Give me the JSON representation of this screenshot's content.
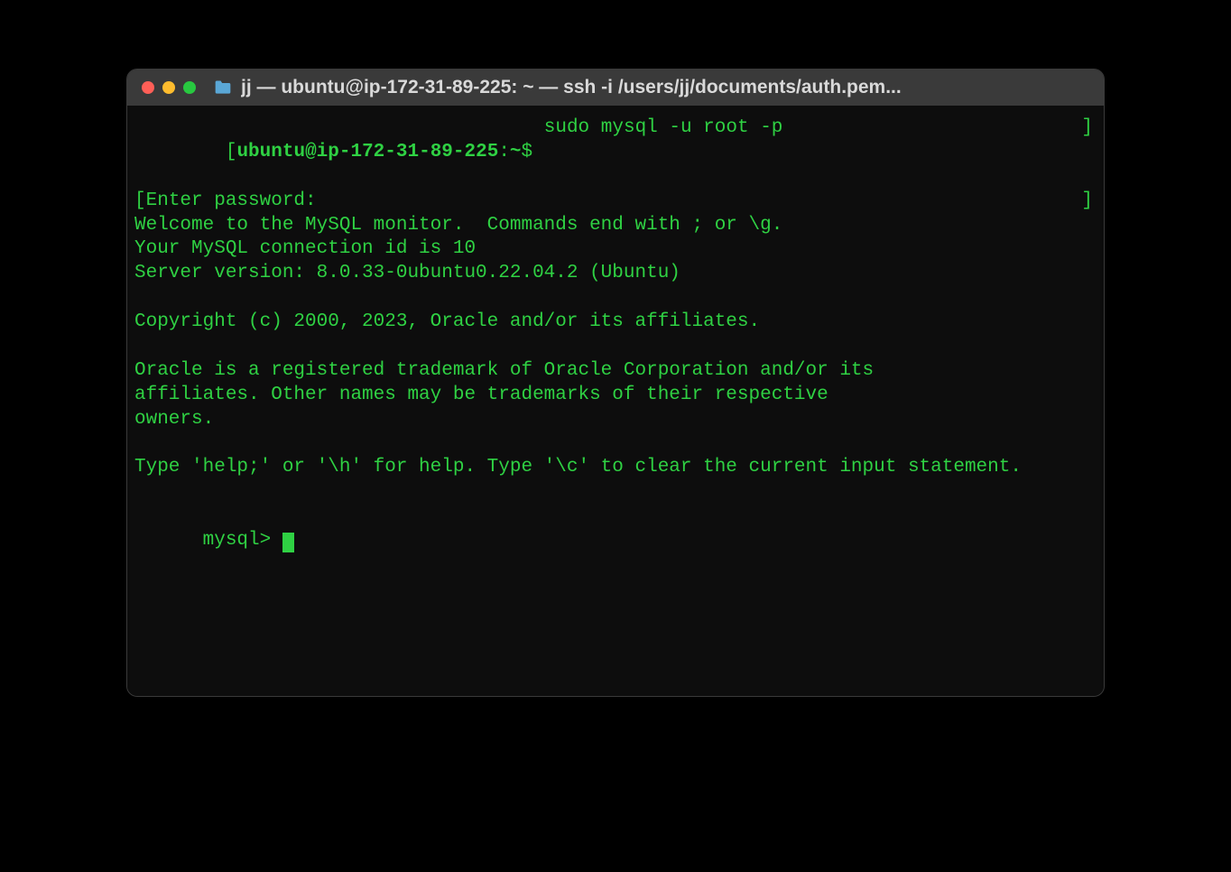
{
  "window": {
    "title": "jj — ubuntu@ip-172-31-89-225: ~ — ssh -i /users/jj/documents/auth.pem..."
  },
  "prompt": {
    "open_bracket": "[",
    "user": "ubuntu",
    "at": "@",
    "host": "ip-172-31-89-225",
    "colon": ":",
    "path": "~",
    "dollar": "$ ",
    "close_bracket": "]"
  },
  "command": "sudo mysql -u root -p",
  "output": {
    "line1_open": "[",
    "line1": "Enter password:",
    "line1_close": "]",
    "line2": "Welcome to the MySQL monitor.  Commands end with ; or \\g.",
    "line3": "Your MySQL connection id is 10",
    "line4": "Server version: 8.0.33-0ubuntu0.22.04.2 (Ubuntu)",
    "line5": "",
    "line6": "Copyright (c) 2000, 2023, Oracle and/or its affiliates.",
    "line7": "",
    "line8": "Oracle is a registered trademark of Oracle Corporation and/or its",
    "line9": "affiliates. Other names may be trademarks of their respective",
    "line10": "owners.",
    "line11": "",
    "line12": "Type 'help;' or '\\h' for help. Type '\\c' to clear the current input statement.",
    "line13": ""
  },
  "mysql_prompt": "mysql> "
}
